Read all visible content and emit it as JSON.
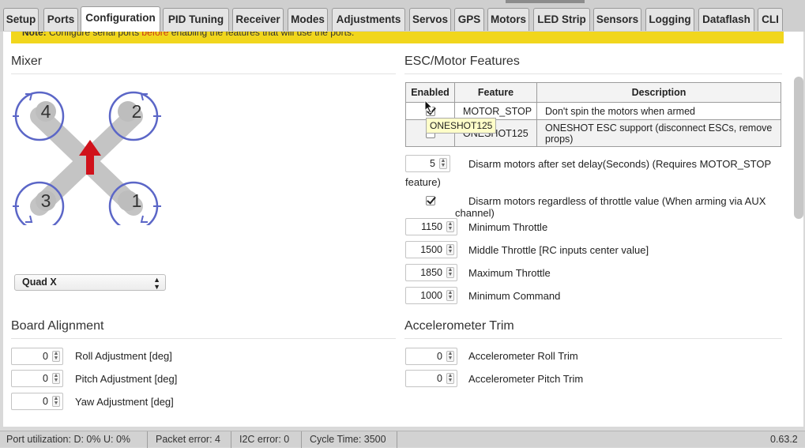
{
  "tabs": [
    "Setup",
    "Ports",
    "Configuration",
    "PID Tuning",
    "Receiver",
    "Modes",
    "Adjustments",
    "Servos",
    "GPS",
    "Motors",
    "LED Strip",
    "Sensors",
    "Logging",
    "Dataflash",
    "CLI"
  ],
  "active_tab": "Configuration",
  "note": {
    "prefix": "Note:",
    "text_a": "Configure serial ports",
    "text_red": "before",
    "text_b": "enabling the features that will use the ports."
  },
  "mixer": {
    "title": "Mixer",
    "motor_numbers": [
      "4",
      "2",
      "3",
      "1"
    ],
    "selected": "Quad X"
  },
  "esc": {
    "title": "ESC/Motor Features",
    "headers": {
      "enabled": "Enabled",
      "feature": "Feature",
      "description": "Description"
    },
    "rows": [
      {
        "feature": "MOTOR_STOP",
        "description": "Don't spin the motors when armed",
        "enabled": true
      },
      {
        "feature": "ONESHOT125",
        "description": "ONESHOT ESC support (disconnect ESCs, remove props)",
        "enabled": false
      }
    ],
    "tooltip": "ONESHOT125",
    "disarm_delay": {
      "value": "5",
      "label_a": "Disarm motors after set delay(Seconds) (Requires MOTOR_STOP",
      "label_b": "feature)"
    },
    "disarm_throttle": {
      "label_a": "Disarm motors regardless of throttle value (When arming via AUX",
      "label_b": "channel)"
    },
    "throttles": [
      {
        "value": "1150",
        "label": "Minimum Throttle"
      },
      {
        "value": "1500",
        "label": "Middle Throttle [RC inputs center value]"
      },
      {
        "value": "1850",
        "label": "Maximum Throttle"
      },
      {
        "value": "1000",
        "label": "Minimum Command"
      }
    ]
  },
  "board": {
    "title": "Board Alignment",
    "items": [
      {
        "value": "0",
        "label": "Roll Adjustment [deg]"
      },
      {
        "value": "0",
        "label": "Pitch Adjustment [deg]"
      },
      {
        "value": "0",
        "label": "Yaw Adjustment [deg]"
      }
    ]
  },
  "acc": {
    "title": "Accelerometer Trim",
    "items": [
      {
        "value": "0",
        "label": "Accelerometer Roll Trim"
      },
      {
        "value": "0",
        "label": "Accelerometer Pitch Trim"
      }
    ]
  },
  "status": {
    "port": "Port utilization: D: 0% U: 0%",
    "packet": "Packet error: 4",
    "i2c": "I2C error: 0",
    "cycle": "Cycle Time: 3500",
    "version": "0.63.2"
  },
  "colors": {
    "accent_yellow": "#f1d61d",
    "arrow_red": "#d0121b",
    "prop_blue": "#5b66c7",
    "frame_grey": "#c4c4c4"
  }
}
